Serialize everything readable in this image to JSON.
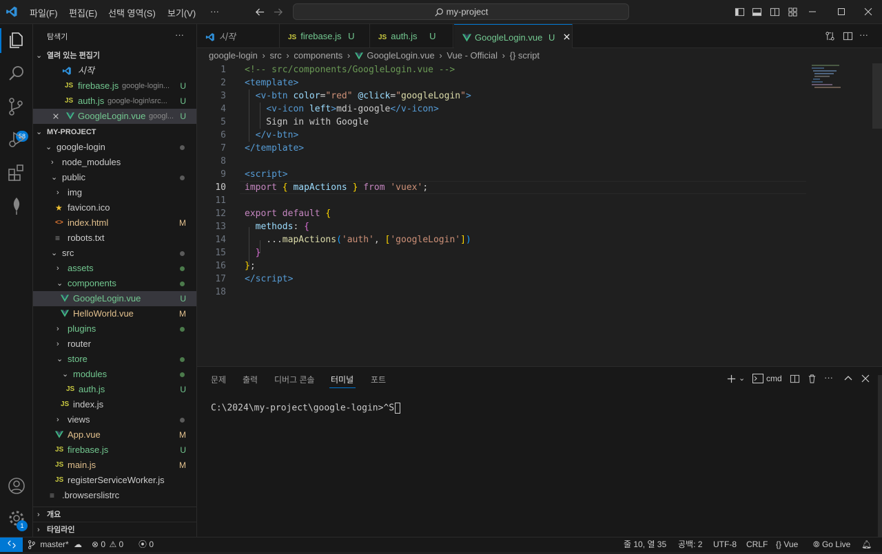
{
  "titlebar": {
    "menus": [
      "파일(F)",
      "편집(E)",
      "선택 영역(S)",
      "보기(V)",
      "···"
    ],
    "search": "my-project"
  },
  "sidebar": {
    "title": "탐색기",
    "more": "···",
    "open_editors": {
      "label": "열려 있는 편집기",
      "items": [
        {
          "icon": "vscode-icon",
          "name": "시작",
          "path": "",
          "status": ""
        },
        {
          "icon": "JS",
          "name": "firebase.js",
          "path": "google-login...",
          "status": "U"
        },
        {
          "icon": "JS",
          "name": "auth.js",
          "path": "google-login\\src...",
          "status": "U"
        },
        {
          "icon": "vue-icon",
          "name": "GoogleLogin.vue",
          "path": "googl...",
          "status": "U"
        }
      ]
    },
    "project": {
      "label": "MY-PROJECT",
      "items": [
        {
          "name": "google-login",
          "kind": "folder-open",
          "depth": 1,
          "badge": "dot"
        },
        {
          "name": "node_modules",
          "kind": "folder",
          "depth": 2,
          "badge": ""
        },
        {
          "name": "public",
          "kind": "folder-open",
          "depth": 2,
          "badge": "dot"
        },
        {
          "name": "img",
          "kind": "folder",
          "depth": 3,
          "badge": ""
        },
        {
          "name": "favicon.ico",
          "kind": "star",
          "depth": 3,
          "badge": ""
        },
        {
          "name": "index.html",
          "kind": "html",
          "depth": 3,
          "badge": "M"
        },
        {
          "name": "robots.txt",
          "kind": "text",
          "depth": 3,
          "badge": ""
        },
        {
          "name": "src",
          "kind": "folder-open",
          "depth": 2,
          "badge": "dot"
        },
        {
          "name": "assets",
          "kind": "folder",
          "depth": 3,
          "badge": "dotg"
        },
        {
          "name": "components",
          "kind": "folder-open",
          "depth": 3,
          "badge": "dotg"
        },
        {
          "name": "GoogleLogin.vue",
          "kind": "vue",
          "depth": 4,
          "badge": "U"
        },
        {
          "name": "HelloWorld.vue",
          "kind": "vue",
          "depth": 4,
          "badge": "M"
        },
        {
          "name": "plugins",
          "kind": "folder",
          "depth": 3,
          "badge": "dotg"
        },
        {
          "name": "router",
          "kind": "folder",
          "depth": 3,
          "badge": ""
        },
        {
          "name": "store",
          "kind": "folder-open",
          "depth": 3,
          "badge": "dotg"
        },
        {
          "name": "modules",
          "kind": "folder-open",
          "depth": 4,
          "badge": "dotg"
        },
        {
          "name": "auth.js",
          "kind": "js",
          "depth": 5,
          "badge": "U"
        },
        {
          "name": "index.js",
          "kind": "js",
          "depth": 4,
          "badge": ""
        },
        {
          "name": "views",
          "kind": "folder",
          "depth": 3,
          "badge": "dot"
        },
        {
          "name": "App.vue",
          "kind": "vue",
          "depth": 3,
          "badge": "M"
        },
        {
          "name": "firebase.js",
          "kind": "js",
          "depth": 3,
          "badge": "U"
        },
        {
          "name": "main.js",
          "kind": "js",
          "depth": 3,
          "badge": "M"
        },
        {
          "name": "registerServiceWorker.js",
          "kind": "js",
          "depth": 3,
          "badge": ""
        },
        {
          "name": ".browserslistrc",
          "kind": "text",
          "depth": 2,
          "badge": ""
        }
      ]
    },
    "outline": "개요",
    "timeline": "타임라인"
  },
  "tabs": [
    {
      "icon": "vscode-icon",
      "label": "시작",
      "status": ""
    },
    {
      "icon": "JS",
      "label": "firebase.js",
      "status": "U"
    },
    {
      "icon": "JS",
      "label": "auth.js",
      "status": "U"
    },
    {
      "icon": "vue-icon",
      "label": "GoogleLogin.vue",
      "status": "U"
    }
  ],
  "breadcrumb": [
    "google-login",
    "src",
    "components",
    "GoogleLogin.vue",
    "Vue - Official",
    "{} script"
  ],
  "editor": {
    "current_line": 10,
    "line_numbers": [
      "1",
      "2",
      "3",
      "4",
      "5",
      "6",
      "7",
      "8",
      "9",
      "10",
      "11",
      "12",
      "13",
      "14",
      "15",
      "16",
      "17",
      "18"
    ]
  },
  "panel": {
    "tabs": [
      "문제",
      "출력",
      "디버그 콘솔",
      "터미널",
      "포트"
    ],
    "active": "터미널",
    "shell": "cmd",
    "terminal_line": "C:\\2024\\my-project\\google-login>^S"
  },
  "activity": {
    "scm_badge": "58",
    "settings_badge": "1"
  },
  "statusbar": {
    "branch": "master*",
    "errors": "0",
    "warnings": "0",
    "ports": "0",
    "position": "줄 10, 열 35",
    "spaces": "공백: 2",
    "encoding": "UTF-8",
    "eol": "CRLF",
    "language": "Vue",
    "golive": "Go Live"
  },
  "colors": {
    "accent": "#0078d4",
    "vue": "#41b883",
    "js": "#cbcb41",
    "modified": "#e2c08d",
    "untracked": "#73c991"
  }
}
